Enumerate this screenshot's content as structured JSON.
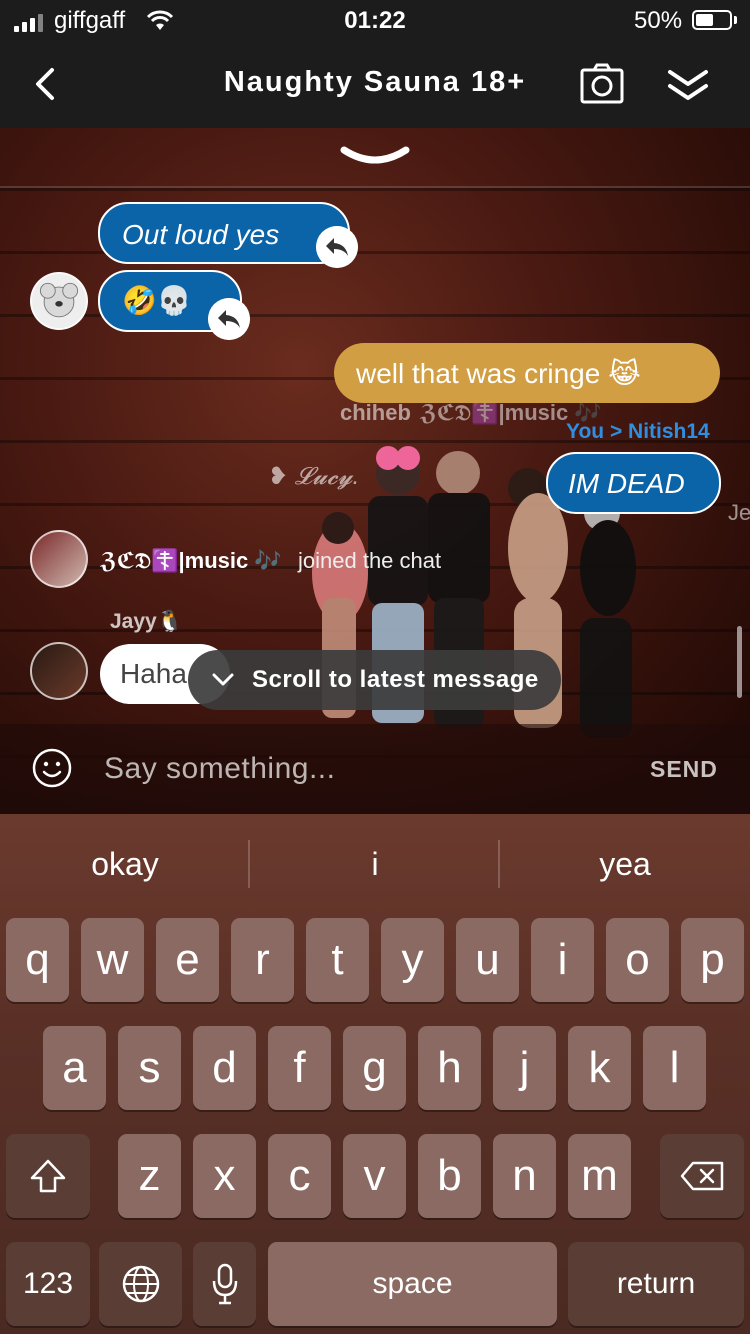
{
  "status_bar": {
    "carrier": "giffgaff",
    "time": "01:22",
    "battery_pct": "50%"
  },
  "header": {
    "title": "Naughty Sauna 18+"
  },
  "messages": {
    "bubble1": "Out loud yes",
    "bubble2": "🤣💀",
    "bubble3": "well that was cringe 😹",
    "reply_label": "You > Nitish14",
    "bubble4": "IM DEAD",
    "join_user": "ℨℭ𝔇☦️|music 🎶",
    "join_text": "joined the chat",
    "sender_jayy": "Jayy🐧",
    "bubble5": "Haha"
  },
  "scene_labels": {
    "chiheb": "chiheb",
    "music_tag": "ℨℭ𝔇☦️|music 🎶",
    "lucy": "❥ 𝓛𝓾𝓬𝔂.",
    "je": "Je"
  },
  "scroll_pill": {
    "label": "Scroll to latest message"
  },
  "composer": {
    "placeholder": "Say something...",
    "send": "SEND"
  },
  "keyboard": {
    "suggestions": [
      "okay",
      "i",
      "yea"
    ],
    "row1": [
      "q",
      "w",
      "e",
      "r",
      "t",
      "y",
      "u",
      "i",
      "o",
      "p"
    ],
    "row2": [
      "a",
      "s",
      "d",
      "f",
      "g",
      "h",
      "j",
      "k",
      "l"
    ],
    "row3": [
      "z",
      "x",
      "c",
      "v",
      "b",
      "n",
      "m"
    ],
    "numbers_key": "123",
    "space_key": "space",
    "return_key": "return"
  },
  "colors": {
    "blue_bubble": "#0c64a8",
    "gold_bubble": "#d19e44",
    "link_blue": "#2e8fe0"
  }
}
